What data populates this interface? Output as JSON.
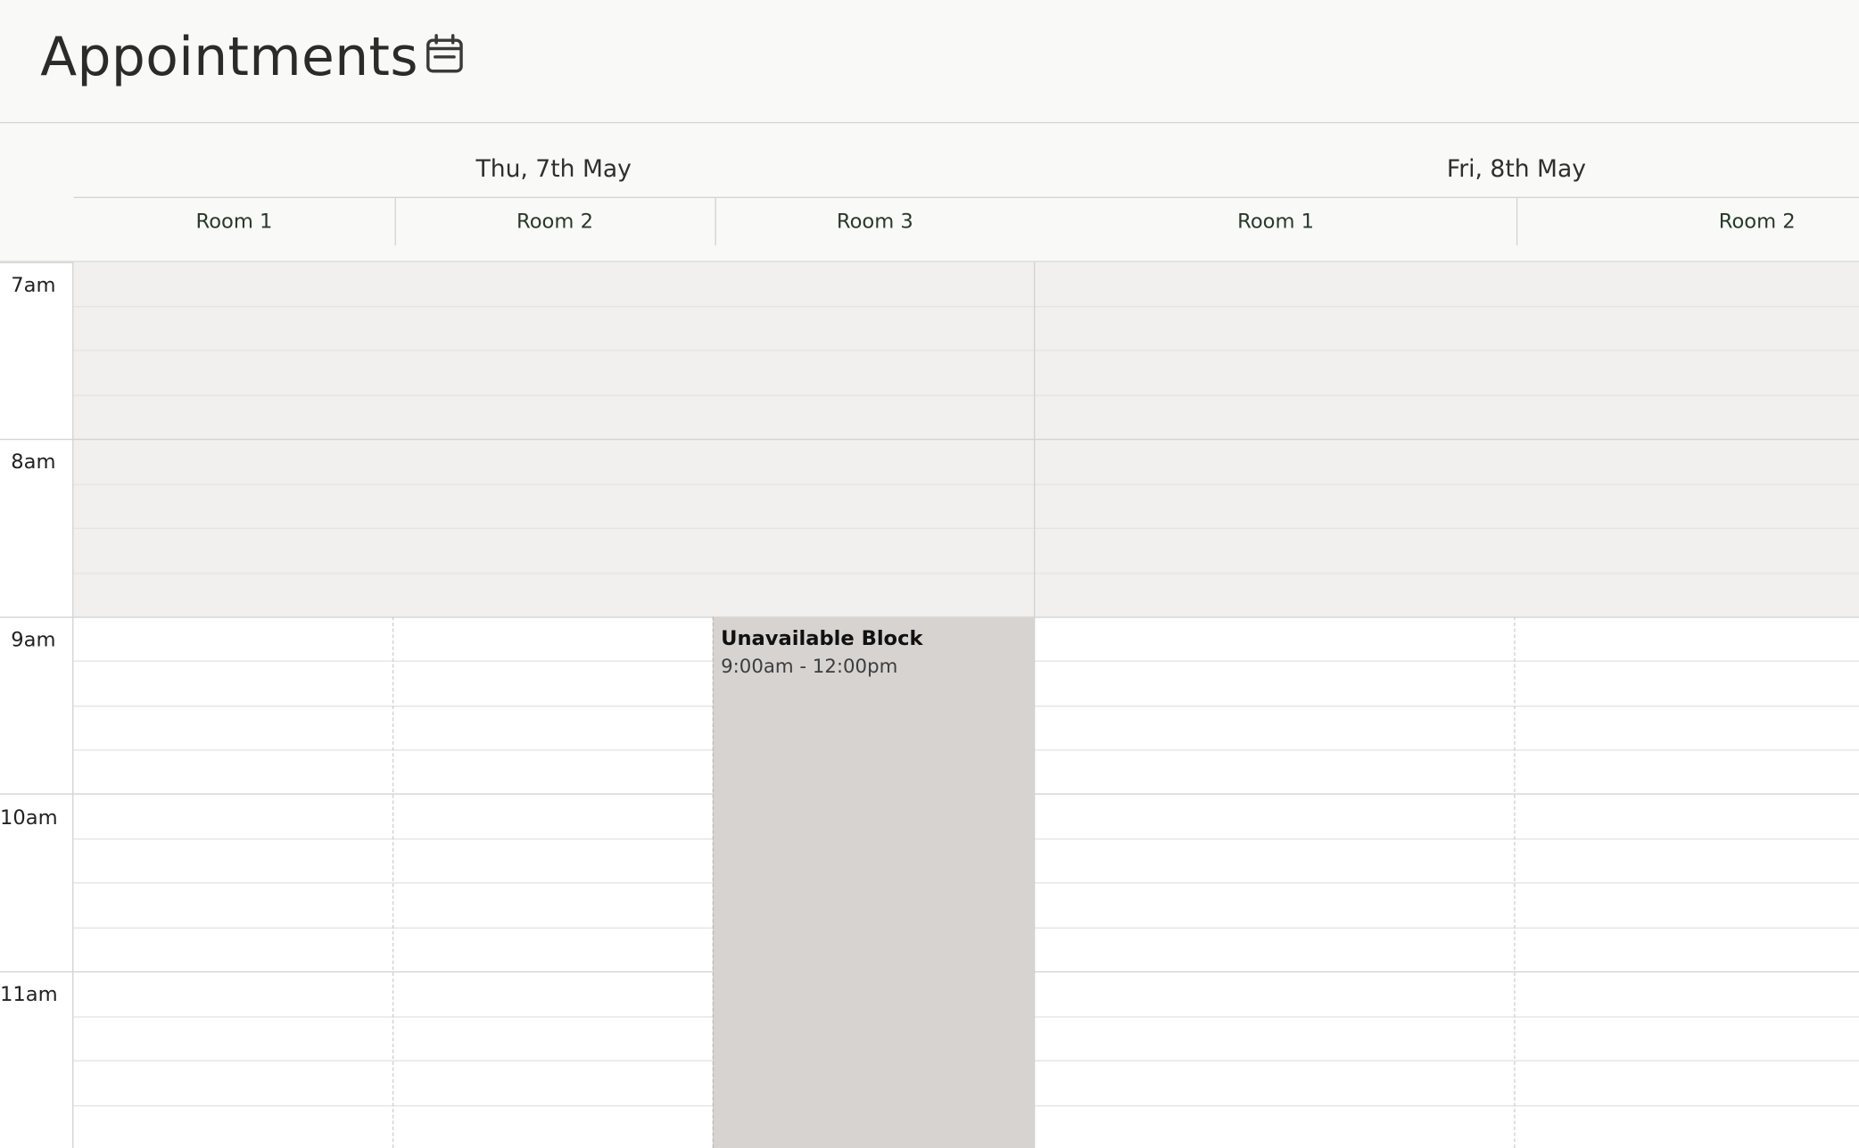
{
  "header": {
    "title": "Appointments",
    "calendar_icon": "calendar-icon"
  },
  "days": [
    {
      "label": "Thu, 7th May",
      "rooms": [
        "Room 1",
        "Room 2",
        "Room 3"
      ]
    },
    {
      "label": "Fri, 8th May",
      "rooms": [
        "Room 1",
        "Room 2"
      ]
    }
  ],
  "time_labels": [
    "7am",
    "8am",
    "9am",
    "10am",
    "11am"
  ],
  "event": {
    "title": "Unavailable Block",
    "time": "9:00am - 12:00pm"
  },
  "colors": {
    "header_bg": "#f9f9f7",
    "unavailable_shade": "#f1f0ee",
    "event_block": "#d6d3d1"
  }
}
